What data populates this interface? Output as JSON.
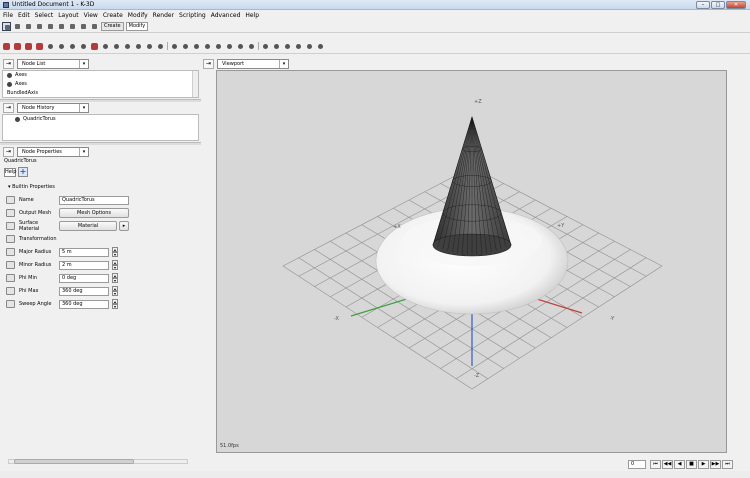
{
  "window": {
    "title": "Untitled Document 1 - K-3D",
    "min": "–",
    "max": "□",
    "close": "✕"
  },
  "menu": [
    "File",
    "Edit",
    "Select",
    "Layout",
    "View",
    "Create",
    "Modify",
    "Render",
    "Scripting",
    "Advanced",
    "Help"
  ],
  "toolbar": {
    "tabs": [
      "Create",
      "Modify"
    ]
  },
  "node_list": {
    "selector": "Node List",
    "items": [
      "Axes",
      "Axes",
      "BundledAxis"
    ]
  },
  "node_history": {
    "selector": "Node History",
    "items": [
      "QuadricTorus"
    ]
  },
  "node_properties": {
    "selector": "Node Properties",
    "node_name": "QuadricTorus",
    "help_label": "Help",
    "group": "Builtin Properties",
    "props": [
      {
        "label": "Name",
        "value": "QuadricTorus"
      },
      {
        "label": "Output Mesh",
        "value": "Mesh Options"
      },
      {
        "label": "Surface Material",
        "value": "Material"
      },
      {
        "label": "Transformation",
        "value": ""
      },
      {
        "label": "Major Radius",
        "value": "5 m"
      },
      {
        "label": "Minor Radius",
        "value": "2 m"
      },
      {
        "label": "Phi Min",
        "value": "0 deg"
      },
      {
        "label": "Phi Max",
        "value": "360 deg"
      },
      {
        "label": "Sweep Angle",
        "value": "360 deg"
      }
    ]
  },
  "viewport": {
    "selector": "Viewport",
    "fps": "51.0fps",
    "axis_labels": {
      "pz": "+Z",
      "nz": "-Z",
      "px": "+X",
      "nx": "-X",
      "py": "+Y",
      "ny": "-Y"
    }
  },
  "timeline": {
    "frame": "0",
    "controls": [
      "⏮",
      "◀◀",
      "◀",
      "■",
      "▶",
      "▶▶",
      "⏭"
    ]
  },
  "colors": {
    "viewport_bg": "#d7d7d7",
    "x_axis": "#c04040",
    "y_axis": "#40a040",
    "z_axis": "#3a5ac0",
    "toolbar_red": "#b53a3a"
  }
}
